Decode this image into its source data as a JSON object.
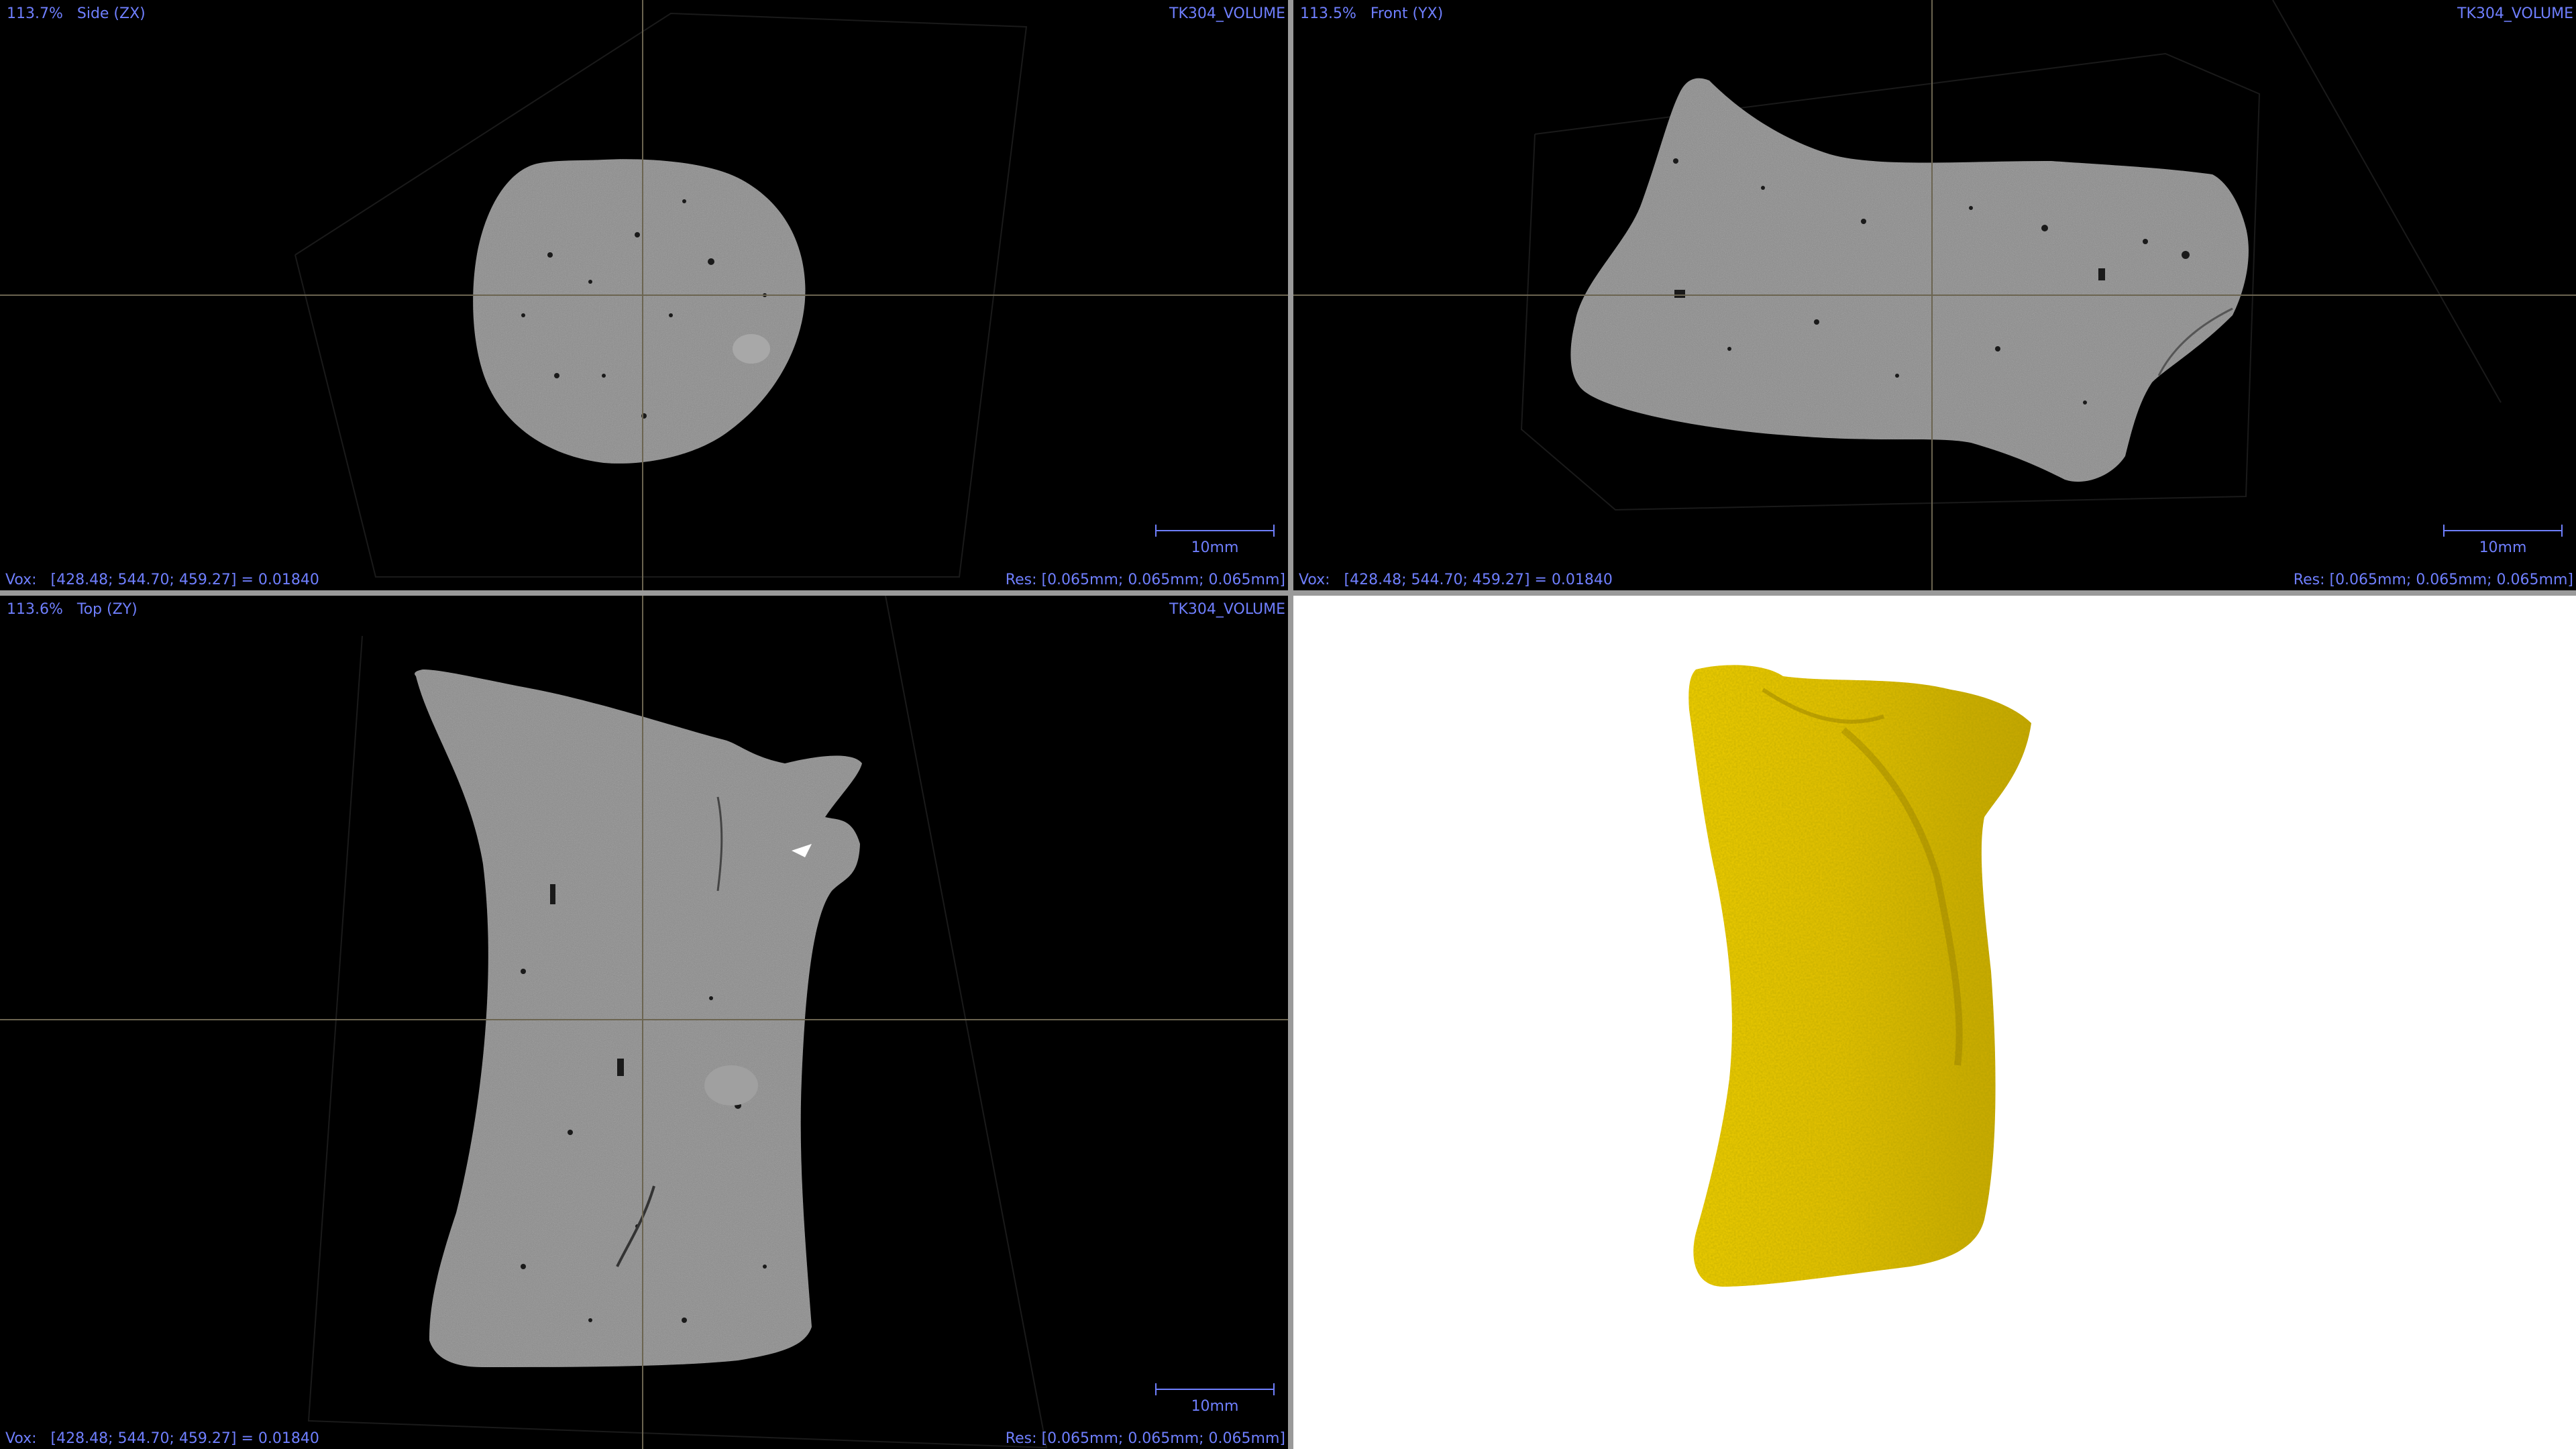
{
  "viewports": {
    "side": {
      "zoom_view": "113.7%   Side (ZX)",
      "volume_name": "TK304_VOLUME",
      "vox_readout": "Vox:   [428.48; 544.70; 459.27] = 0.01840",
      "res_readout": "Res: [0.065mm; 0.065mm; 0.065mm]",
      "scale_label": "10mm"
    },
    "front": {
      "zoom_view": "113.5%   Front (YX)",
      "volume_name": "TK304_VOLUME",
      "vox_readout": "Vox:   [428.48; 544.70; 459.27] = 0.01840",
      "res_readout": "Res: [0.065mm; 0.065mm; 0.065mm]",
      "scale_label": "10mm"
    },
    "top": {
      "zoom_view": "113.6%   Top (ZY)",
      "volume_name": "TK304_VOLUME",
      "vox_readout": "Vox:   [428.48; 544.70; 459.27] = 0.01840",
      "res_readout": "Res: [0.065mm; 0.065mm; 0.065mm]",
      "scale_label": "10mm"
    }
  },
  "colors": {
    "overlay_text": "#6f7fff",
    "slice_gray": "#8a8a8a",
    "model_yellow": "#e8c400",
    "crosshair": "#6b6450"
  }
}
